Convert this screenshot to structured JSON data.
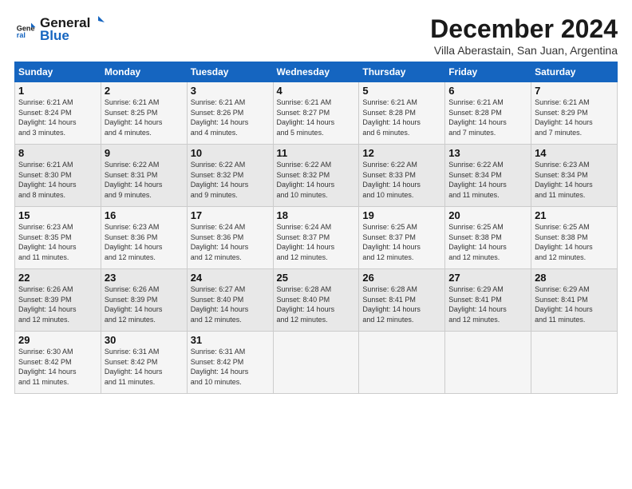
{
  "logo": {
    "line1": "General",
    "line2": "Blue"
  },
  "title": "December 2024",
  "subtitle": "Villa Aberastain, San Juan, Argentina",
  "days_of_week": [
    "Sunday",
    "Monday",
    "Tuesday",
    "Wednesday",
    "Thursday",
    "Friday",
    "Saturday"
  ],
  "weeks": [
    [
      {
        "day": "1",
        "info": "Sunrise: 6:21 AM\nSunset: 8:24 PM\nDaylight: 14 hours\nand 3 minutes."
      },
      {
        "day": "2",
        "info": "Sunrise: 6:21 AM\nSunset: 8:25 PM\nDaylight: 14 hours\nand 4 minutes."
      },
      {
        "day": "3",
        "info": "Sunrise: 6:21 AM\nSunset: 8:26 PM\nDaylight: 14 hours\nand 4 minutes."
      },
      {
        "day": "4",
        "info": "Sunrise: 6:21 AM\nSunset: 8:27 PM\nDaylight: 14 hours\nand 5 minutes."
      },
      {
        "day": "5",
        "info": "Sunrise: 6:21 AM\nSunset: 8:28 PM\nDaylight: 14 hours\nand 6 minutes."
      },
      {
        "day": "6",
        "info": "Sunrise: 6:21 AM\nSunset: 8:28 PM\nDaylight: 14 hours\nand 7 minutes."
      },
      {
        "day": "7",
        "info": "Sunrise: 6:21 AM\nSunset: 8:29 PM\nDaylight: 14 hours\nand 7 minutes."
      }
    ],
    [
      {
        "day": "8",
        "info": "Sunrise: 6:21 AM\nSunset: 8:30 PM\nDaylight: 14 hours\nand 8 minutes."
      },
      {
        "day": "9",
        "info": "Sunrise: 6:22 AM\nSunset: 8:31 PM\nDaylight: 14 hours\nand 9 minutes."
      },
      {
        "day": "10",
        "info": "Sunrise: 6:22 AM\nSunset: 8:32 PM\nDaylight: 14 hours\nand 9 minutes."
      },
      {
        "day": "11",
        "info": "Sunrise: 6:22 AM\nSunset: 8:32 PM\nDaylight: 14 hours\nand 10 minutes."
      },
      {
        "day": "12",
        "info": "Sunrise: 6:22 AM\nSunset: 8:33 PM\nDaylight: 14 hours\nand 10 minutes."
      },
      {
        "day": "13",
        "info": "Sunrise: 6:22 AM\nSunset: 8:34 PM\nDaylight: 14 hours\nand 11 minutes."
      },
      {
        "day": "14",
        "info": "Sunrise: 6:23 AM\nSunset: 8:34 PM\nDaylight: 14 hours\nand 11 minutes."
      }
    ],
    [
      {
        "day": "15",
        "info": "Sunrise: 6:23 AM\nSunset: 8:35 PM\nDaylight: 14 hours\nand 11 minutes."
      },
      {
        "day": "16",
        "info": "Sunrise: 6:23 AM\nSunset: 8:36 PM\nDaylight: 14 hours\nand 12 minutes."
      },
      {
        "day": "17",
        "info": "Sunrise: 6:24 AM\nSunset: 8:36 PM\nDaylight: 14 hours\nand 12 minutes."
      },
      {
        "day": "18",
        "info": "Sunrise: 6:24 AM\nSunset: 8:37 PM\nDaylight: 14 hours\nand 12 minutes."
      },
      {
        "day": "19",
        "info": "Sunrise: 6:25 AM\nSunset: 8:37 PM\nDaylight: 14 hours\nand 12 minutes."
      },
      {
        "day": "20",
        "info": "Sunrise: 6:25 AM\nSunset: 8:38 PM\nDaylight: 14 hours\nand 12 minutes."
      },
      {
        "day": "21",
        "info": "Sunrise: 6:25 AM\nSunset: 8:38 PM\nDaylight: 14 hours\nand 12 minutes."
      }
    ],
    [
      {
        "day": "22",
        "info": "Sunrise: 6:26 AM\nSunset: 8:39 PM\nDaylight: 14 hours\nand 12 minutes."
      },
      {
        "day": "23",
        "info": "Sunrise: 6:26 AM\nSunset: 8:39 PM\nDaylight: 14 hours\nand 12 minutes."
      },
      {
        "day": "24",
        "info": "Sunrise: 6:27 AM\nSunset: 8:40 PM\nDaylight: 14 hours\nand 12 minutes."
      },
      {
        "day": "25",
        "info": "Sunrise: 6:28 AM\nSunset: 8:40 PM\nDaylight: 14 hours\nand 12 minutes."
      },
      {
        "day": "26",
        "info": "Sunrise: 6:28 AM\nSunset: 8:41 PM\nDaylight: 14 hours\nand 12 minutes."
      },
      {
        "day": "27",
        "info": "Sunrise: 6:29 AM\nSunset: 8:41 PM\nDaylight: 14 hours\nand 12 minutes."
      },
      {
        "day": "28",
        "info": "Sunrise: 6:29 AM\nSunset: 8:41 PM\nDaylight: 14 hours\nand 11 minutes."
      }
    ],
    [
      {
        "day": "29",
        "info": "Sunrise: 6:30 AM\nSunset: 8:42 PM\nDaylight: 14 hours\nand 11 minutes."
      },
      {
        "day": "30",
        "info": "Sunrise: 6:31 AM\nSunset: 8:42 PM\nDaylight: 14 hours\nand 11 minutes."
      },
      {
        "day": "31",
        "info": "Sunrise: 6:31 AM\nSunset: 8:42 PM\nDaylight: 14 hours\nand 10 minutes."
      },
      {
        "day": "",
        "info": ""
      },
      {
        "day": "",
        "info": ""
      },
      {
        "day": "",
        "info": ""
      },
      {
        "day": "",
        "info": ""
      }
    ]
  ]
}
